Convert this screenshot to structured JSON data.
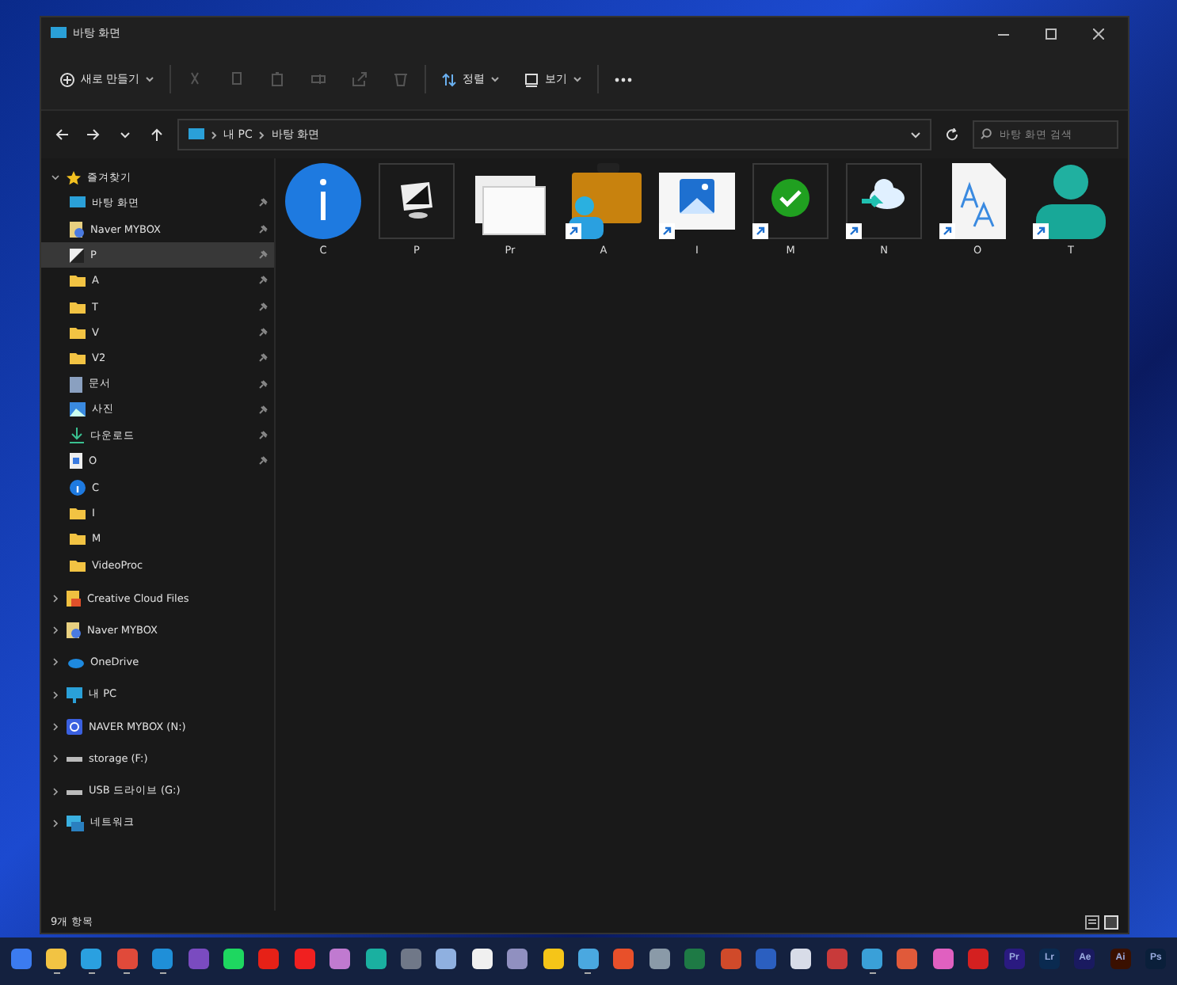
{
  "window": {
    "title": "바탕 화면"
  },
  "toolbar": {
    "new_label": "새로 만들기",
    "actions": [
      {
        "kind": "cut",
        "disabled": true
      },
      {
        "kind": "copy",
        "disabled": true
      },
      {
        "kind": "paste",
        "disabled": true
      },
      {
        "kind": "rename",
        "disabled": true
      },
      {
        "kind": "share",
        "disabled": true
      },
      {
        "kind": "delete",
        "disabled": true
      }
    ],
    "sort_label": "정렬",
    "view_label": "보기"
  },
  "address": {
    "path": [
      "내 PC",
      "바탕 화면"
    ],
    "search_placeholder": "바탕 화면 검색"
  },
  "sidebar": {
    "quick_access": {
      "label": "즐겨찾기",
      "expanded": true,
      "items": [
        {
          "label": "바탕 화면",
          "kind": "desktop",
          "pinned": true,
          "selected": false
        },
        {
          "label": "Naver MYBOX",
          "kind": "mybox",
          "pinned": true,
          "selected": false
        },
        {
          "label": "P",
          "kind": "image",
          "pinned": true,
          "selected": true
        },
        {
          "label": "A",
          "kind": "folder",
          "pinned": true,
          "selected": false
        },
        {
          "label": "T",
          "kind": "folder",
          "pinned": true,
          "selected": false
        },
        {
          "label": "V",
          "kind": "folder",
          "pinned": true,
          "selected": false
        },
        {
          "label": "V2",
          "kind": "folder",
          "pinned": true,
          "selected": false
        },
        {
          "label": "문서",
          "kind": "document",
          "pinned": true,
          "selected": false
        },
        {
          "label": "사진",
          "kind": "pictures",
          "pinned": true,
          "selected": false
        },
        {
          "label": "다운로드",
          "kind": "download",
          "pinned": true,
          "selected": false
        },
        {
          "label": "O",
          "kind": "file",
          "pinned": true,
          "selected": false
        },
        {
          "label": "C",
          "kind": "info",
          "pinned": false,
          "selected": false
        },
        {
          "label": "I",
          "kind": "folder",
          "pinned": false,
          "selected": false
        },
        {
          "label": "M",
          "kind": "folder",
          "pinned": false,
          "selected": false
        },
        {
          "label": "VideoProc",
          "kind": "folder",
          "pinned": false,
          "selected": false
        }
      ]
    },
    "sections": [
      {
        "label": "Creative Cloud Files",
        "kind": "creative",
        "expanded": false
      },
      {
        "label": "Naver MYBOX",
        "kind": "mybox",
        "expanded": false
      },
      {
        "label": "OneDrive",
        "kind": "onedrive",
        "expanded": false
      },
      {
        "label": "내 PC",
        "kind": "pc",
        "expanded": false
      },
      {
        "label": "NAVER MYBOX (N:)",
        "kind": "naverdrive",
        "expanded": false
      },
      {
        "label": "storage (F:)",
        "kind": "drive",
        "expanded": false
      },
      {
        "label": "USB 드라이브 (G:)",
        "kind": "drive",
        "expanded": false
      },
      {
        "label": "네트워크",
        "kind": "network",
        "expanded": false
      }
    ]
  },
  "files": [
    {
      "label": "C",
      "kind": "info",
      "shortcut": false
    },
    {
      "label": "P",
      "kind": "monitor",
      "shortcut": false
    },
    {
      "label": "Pr",
      "kind": "windows",
      "shortcut": false
    },
    {
      "label": "A",
      "kind": "briefcase",
      "shortcut": true
    },
    {
      "label": "I",
      "kind": "picture",
      "shortcut": true
    },
    {
      "label": "M",
      "kind": "check",
      "shortcut": true
    },
    {
      "label": "N",
      "kind": "cloud",
      "shortcut": true
    },
    {
      "label": "O",
      "kind": "font",
      "shortcut": true
    },
    {
      "label": "T",
      "kind": "person",
      "shortcut": true
    }
  ],
  "status_bar": {
    "count": "9개 항목"
  },
  "taskbar": [
    {
      "color": "#3b7bf0",
      "running": false
    },
    {
      "color": "#f2c343",
      "running": true
    },
    {
      "color": "#2aa0e0",
      "running": true
    },
    {
      "color": "#e04a3a",
      "running": true
    },
    {
      "color": "#1f8fd8",
      "running": true
    },
    {
      "color": "#7a4bc0",
      "running": false
    },
    {
      "color": "#1ed760",
      "running": false
    },
    {
      "color": "#e62117",
      "running": false
    },
    {
      "color": "#f02020",
      "running": false
    },
    {
      "color": "#c07ad0",
      "running": false
    },
    {
      "color": "#1ab0a0",
      "running": false
    },
    {
      "color": "#707888",
      "running": false
    },
    {
      "color": "#8fb0e0",
      "running": false
    },
    {
      "color": "#f0f0f0",
      "running": false
    },
    {
      "color": "#9090c0",
      "running": false
    },
    {
      "color": "#f5c518",
      "running": false
    },
    {
      "color": "#4aa8e0",
      "running": true
    },
    {
      "color": "#e8502a",
      "running": false
    },
    {
      "color": "#8a9aa8",
      "running": false
    },
    {
      "color": "#1e7a45",
      "running": false
    },
    {
      "color": "#d04a2a",
      "running": false
    },
    {
      "color": "#2b5fc0",
      "running": false
    },
    {
      "color": "#d8dce8",
      "running": false
    },
    {
      "color": "#c83a3a",
      "running": false
    },
    {
      "color": "#3aa0d8",
      "running": true
    },
    {
      "color": "#e05a3a",
      "running": false
    },
    {
      "color": "#e060c0",
      "running": false
    },
    {
      "color": "#d42020",
      "running": false
    },
    {
      "color": "#2a1a80",
      "label": "Pr",
      "running": false
    },
    {
      "color": "#0a2a50",
      "label": "Lr",
      "running": false
    },
    {
      "color": "#1a1a60",
      "label": "Ae",
      "running": false
    },
    {
      "color": "#3a1000",
      "label": "Ai",
      "running": false
    },
    {
      "color": "#0a1f3a",
      "label": "Ps",
      "running": false
    }
  ]
}
